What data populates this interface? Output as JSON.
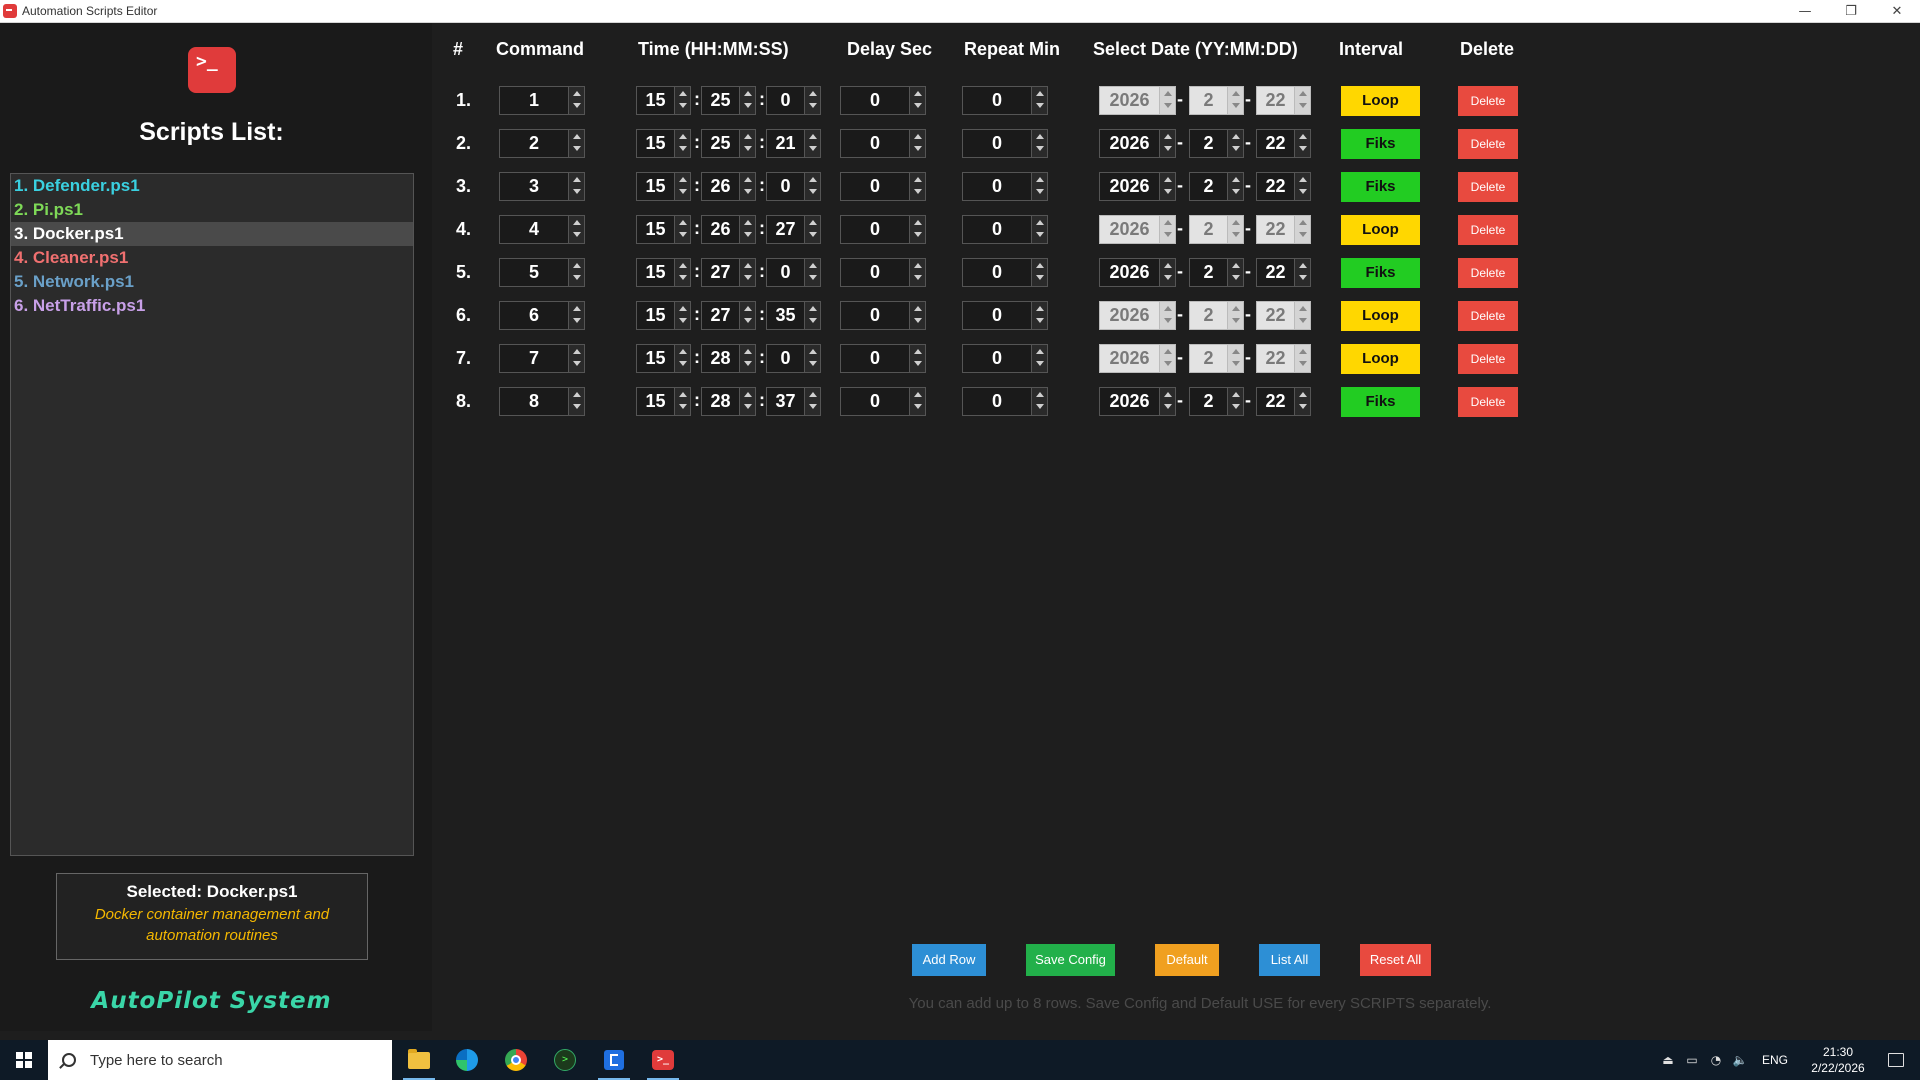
{
  "window": {
    "title": "Automation Scripts Editor",
    "controls": {
      "minimize": "—",
      "restore": "❐",
      "close": "✕"
    }
  },
  "sidebar": {
    "logo_glyph": ">_",
    "title": "Scripts List:",
    "scripts": [
      {
        "label": "1. Defender.ps1",
        "color": "#3ad0e0"
      },
      {
        "label": "2. Pi.ps1",
        "color": "#7ed957"
      },
      {
        "label": "3. Docker.ps1",
        "color": "#ffffff",
        "selected": true
      },
      {
        "label": "4. Cleaner.ps1",
        "color": "#f07070"
      },
      {
        "label": "5. Network.ps1",
        "color": "#6aa0c8"
      },
      {
        "label": "6. NetTraffic.ps1",
        "color": "#c8a0e8"
      }
    ],
    "selected": {
      "title": "Selected: Docker.ps1",
      "description": "Docker container management and automation routines"
    },
    "footer": "AutoPilot System"
  },
  "headers": {
    "num": "#",
    "command": "Command",
    "time": "Time (HH:MM:SS)",
    "delay": "Delay Sec",
    "repeat": "Repeat Min",
    "date": "Select Date (YY:MM:DD)",
    "interval": "Interval",
    "delete": "Delete"
  },
  "rows": [
    {
      "num": "1.",
      "command": "1",
      "hh": "15",
      "mm": "25",
      "ss": "0",
      "delay": "0",
      "repeat": "0",
      "year": "2026",
      "month": "2",
      "day": "22",
      "interval": "Loop",
      "delete": "Delete"
    },
    {
      "num": "2.",
      "command": "2",
      "hh": "15",
      "mm": "25",
      "ss": "21",
      "delay": "0",
      "repeat": "0",
      "year": "2026",
      "month": "2",
      "day": "22",
      "interval": "Fiks",
      "delete": "Delete"
    },
    {
      "num": "3.",
      "command": "3",
      "hh": "15",
      "mm": "26",
      "ss": "0",
      "delay": "0",
      "repeat": "0",
      "year": "2026",
      "month": "2",
      "day": "22",
      "interval": "Fiks",
      "delete": "Delete"
    },
    {
      "num": "4.",
      "command": "4",
      "hh": "15",
      "mm": "26",
      "ss": "27",
      "delay": "0",
      "repeat": "0",
      "year": "2026",
      "month": "2",
      "day": "22",
      "interval": "Loop",
      "delete": "Delete"
    },
    {
      "num": "5.",
      "command": "5",
      "hh": "15",
      "mm": "27",
      "ss": "0",
      "delay": "0",
      "repeat": "0",
      "year": "2026",
      "month": "2",
      "day": "22",
      "interval": "Fiks",
      "delete": "Delete"
    },
    {
      "num": "6.",
      "command": "6",
      "hh": "15",
      "mm": "27",
      "ss": "35",
      "delay": "0",
      "repeat": "0",
      "year": "2026",
      "month": "2",
      "day": "22",
      "interval": "Loop",
      "delete": "Delete"
    },
    {
      "num": "7.",
      "command": "7",
      "hh": "15",
      "mm": "28",
      "ss": "0",
      "delay": "0",
      "repeat": "0",
      "year": "2026",
      "month": "2",
      "day": "22",
      "interval": "Loop",
      "delete": "Delete"
    },
    {
      "num": "8.",
      "command": "8",
      "hh": "15",
      "mm": "28",
      "ss": "37",
      "delay": "0",
      "repeat": "0",
      "year": "2026",
      "month": "2",
      "day": "22",
      "interval": "Fiks",
      "delete": "Delete"
    }
  ],
  "separators": {
    "time": ":",
    "date": "-"
  },
  "buttons": [
    {
      "label": "Add Row",
      "color": "#2d8fd5"
    },
    {
      "label": "Save Config",
      "color": "#22b04a"
    },
    {
      "label": "Default",
      "color": "#f0a020"
    },
    {
      "label": "List All",
      "color": "#2d8fd5"
    },
    {
      "label": "Reset All",
      "color": "#e84a3f"
    }
  ],
  "hint": "You can add up to 8 rows. Save Config and Default USE for every SCRIPTS separately.",
  "taskbar": {
    "search_placeholder": "Type here to search",
    "apps": [
      "file-explorer-icon",
      "edge-icon",
      "chrome-icon",
      "terminal-icon",
      "power-automate-icon",
      "autopilot-app-icon"
    ],
    "tray_glyphs": {
      "usb": "⏏",
      "battery": "▭",
      "wifi": "◔",
      "volume": "🔈"
    },
    "language": "ENG",
    "time": "21:30",
    "date": "2/22/2026"
  }
}
